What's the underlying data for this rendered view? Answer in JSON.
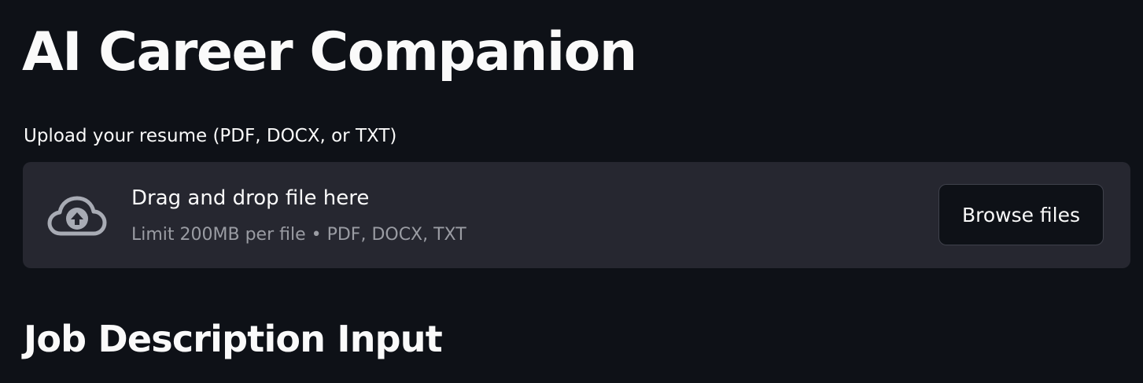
{
  "page": {
    "title": "AI Career Companion"
  },
  "uploader": {
    "label": "Upload your resume (PDF, DOCX, or TXT)",
    "dropzone_title": "Drag and drop file here",
    "dropzone_limit": "Limit 200MB per file • PDF, DOCX, TXT",
    "browse_label": "Browse files",
    "icon": "cloud-upload-icon"
  },
  "section": {
    "heading": "Job Description Input"
  },
  "colors": {
    "background": "#0e1117",
    "dropzone_background": "#262730",
    "text": "#fafafa",
    "muted_text": "#9a9ca3",
    "icon": "#a8abb4",
    "button_border": "#3f414b"
  }
}
